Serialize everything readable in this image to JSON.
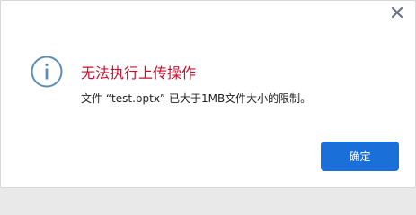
{
  "dialog": {
    "close_icon": "close-icon",
    "info_icon": "info-circle-icon",
    "title": "无法执行上传操作",
    "message": "文件 “test.pptx” 已大于1MB文件大小的限制。",
    "ok_label": "确定"
  },
  "colors": {
    "title": "#c8102e",
    "icon": "#5b8db8",
    "close": "#6b7480",
    "button": "#1a6fd8"
  }
}
